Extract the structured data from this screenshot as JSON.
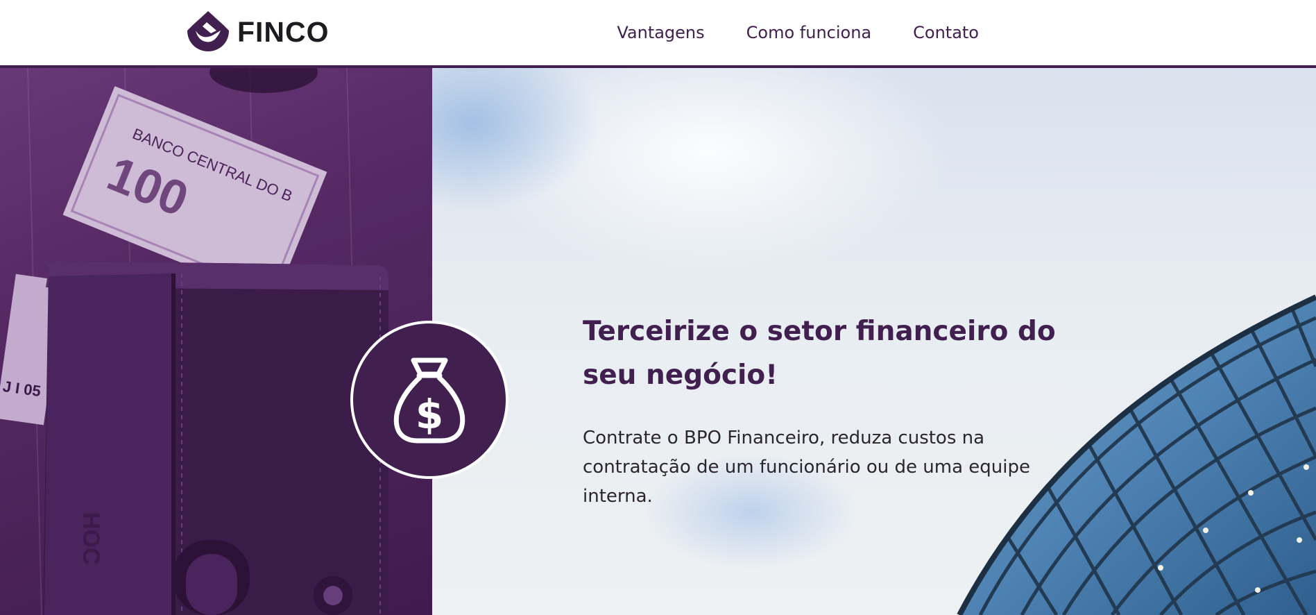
{
  "brand": {
    "name": "FINCO",
    "logo_icon": "finco-logo-icon",
    "color": "#41204f"
  },
  "nav": {
    "items": [
      {
        "label": "Vantagens"
      },
      {
        "label": "Como funciona"
      },
      {
        "label": "Contato"
      }
    ]
  },
  "hero": {
    "title": "Terceirize o setor financeiro do seu negócio!",
    "text": "Contrate o BPO Financeiro, reduza custos na contratação de um funcionário ou de uma equipe interna.",
    "badge_icon": "money-bag-icon",
    "left_image": {
      "banknote_text": "BANCO CENTRAL DO B"
    },
    "colors": {
      "accent": "#41204f",
      "text": "#2b2530"
    }
  }
}
